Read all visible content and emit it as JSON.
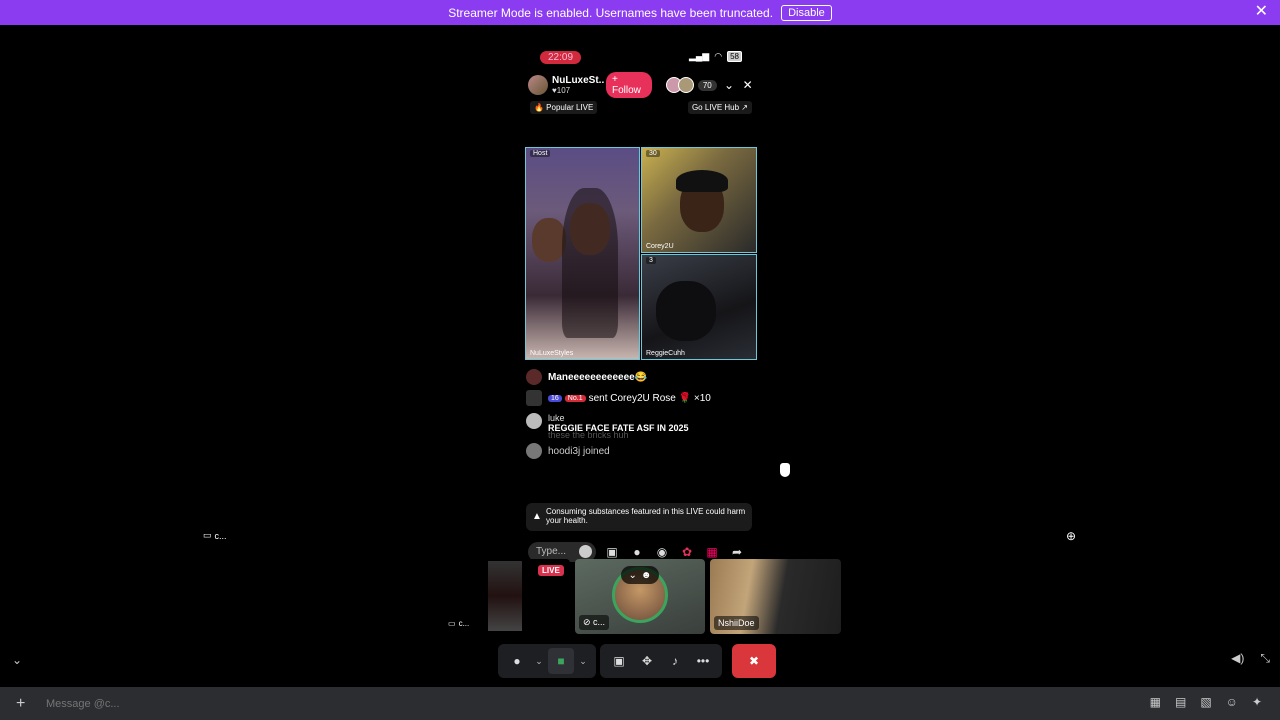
{
  "banner": {
    "text": "Streamer Mode is enabled. Usernames have been truncated.",
    "button": "Disable",
    "close": "✕"
  },
  "phone": {
    "time": "22:09",
    "battery": "58",
    "host_name": "NuLuxeSt...",
    "host_likes": "♥107",
    "follow": "+ Follow",
    "viewer_count": "70",
    "tag_left": "🔥 Popular LIVE",
    "tag_right": "Go LIVE Hub ↗",
    "tiles": {
      "host_label": "Host",
      "host_name": "NuLuxeStyles",
      "c2_label": "30",
      "c2_name": "Corey2U",
      "c3_label": "3",
      "c3_name": "ReggieCuhh"
    },
    "chat": [
      {
        "text": "Maneeeeeeeeeeee😂"
      },
      {
        "badge1": "16",
        "badge2": "No.1",
        "text": "sent Corey2U Rose 🌹 ×10"
      },
      {
        "user": "luke",
        "text": "REGGIE FACE FATE ASF IN 2025",
        "ghost": "these the bricks huh"
      },
      {
        "text": "hoodi3j joined"
      }
    ],
    "warning": "Consuming substances featured in this LIVE could harm your health.",
    "type_placeholder": "Type..."
  },
  "stage": {
    "side_label": "c...",
    "thumbs": {
      "live": "LIVE",
      "left_label": "c...",
      "mid_label": "c...",
      "right_name": "NshiiDoe"
    }
  },
  "message_bar": {
    "placeholder": "Message @c..."
  },
  "colors": {
    "banner": "#8c3cf0",
    "follow": "#e8315a",
    "end_call": "#da373c",
    "speaking": "#3ba55d"
  }
}
